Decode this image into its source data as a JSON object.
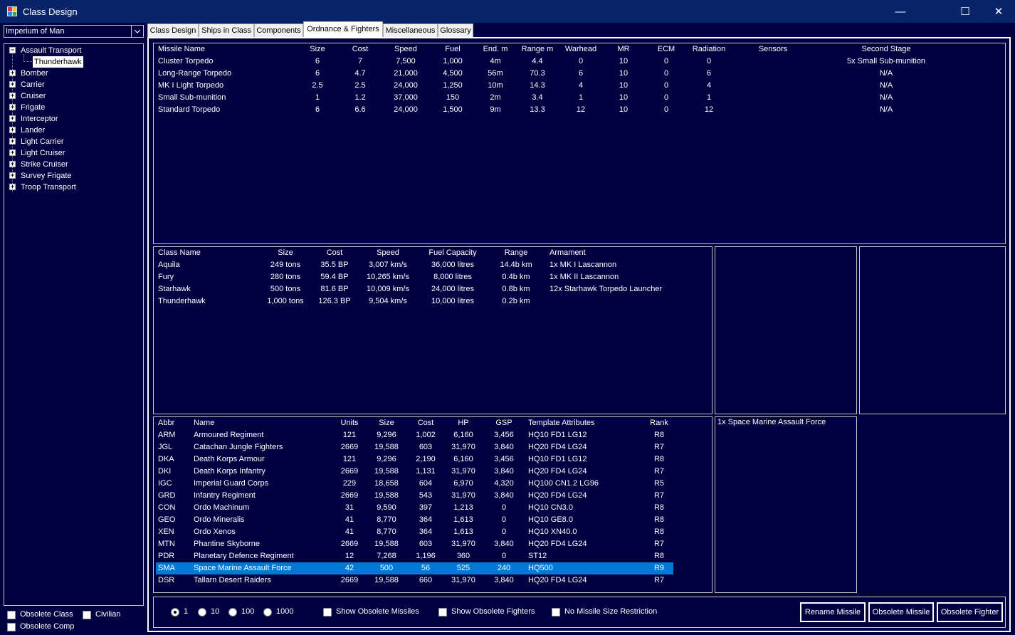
{
  "window": {
    "title": "Class Design",
    "controls": {
      "minimize": "—",
      "maximize": "☐",
      "close": "✕"
    }
  },
  "race_selector": {
    "value": "Imperium of Man"
  },
  "tree": {
    "root_expanded": {
      "label": "Assault Transport",
      "child": "Thunderhawk"
    },
    "items": [
      "Bomber",
      "Carrier",
      "Cruiser",
      "Frigate",
      "Interceptor",
      "Lander",
      "Light Carrier",
      "Light Cruiser",
      "Strike Cruiser",
      "Survey Frigate",
      "Troop Transport"
    ]
  },
  "bottom_left": {
    "obsolete_class": "Obsolete Class",
    "civilian": "Civilian",
    "obsolete_comp": "Obsolete Comp"
  },
  "tabs": [
    "Class Design",
    "Ships in Class",
    "Components",
    "Ordnance & Fighters",
    "Miscellaneous",
    "Glossary"
  ],
  "missiles": {
    "headers": [
      "Missile Name",
      "Size",
      "Cost",
      "Speed",
      "Fuel",
      "End. m",
      "Range m",
      "Warhead",
      "MR",
      "ECM",
      "Radiation",
      "Sensors",
      "Second Stage"
    ],
    "rows": [
      [
        "Cluster Torpedo",
        "6",
        "7",
        "7,500",
        "1,000",
        "4m",
        "4.4",
        "0",
        "10",
        "0",
        "0",
        "",
        "5x Small Sub-munition"
      ],
      [
        "Long-Range Torpedo",
        "6",
        "4.7",
        "21,000",
        "4,500",
        "56m",
        "70.3",
        "6",
        "10",
        "0",
        "6",
        "",
        "N/A"
      ],
      [
        "MK I Light Torpedo",
        "2.5",
        "2.5",
        "24,000",
        "1,250",
        "10m",
        "14.3",
        "4",
        "10",
        "0",
        "4",
        "",
        "N/A"
      ],
      [
        "Small Sub-munition",
        "1",
        "1.2",
        "37,000",
        "150",
        "2m",
        "3.4",
        "1",
        "10",
        "0",
        "1",
        "",
        "N/A"
      ],
      [
        "Standard Torpedo",
        "6",
        "6.6",
        "24,000",
        "1,500",
        "9m",
        "13.3",
        "12",
        "10",
        "0",
        "12",
        "",
        "N/A"
      ]
    ]
  },
  "fighters": {
    "headers": [
      "Class Name",
      "Size",
      "Cost",
      "Speed",
      "Fuel Capacity",
      "Range",
      "Armament"
    ],
    "rows": [
      [
        "Aquila",
        "249 tons",
        "35.5 BP",
        "3,007 km/s",
        "36,000 litres",
        "14.4b km",
        "1x MK I Lascannon"
      ],
      [
        "Fury",
        "280 tons",
        "59.4 BP",
        "10,265 km/s",
        "8,000 litres",
        "0.4b km",
        "1x MK II Lascannon"
      ],
      [
        "Starhawk",
        "500 tons",
        "81.6 BP",
        "10,009 km/s",
        "24,000 litres",
        "0.8b km",
        "12x Starhawk Torpedo Launcher"
      ],
      [
        "Thunderhawk",
        "1,000 tons",
        "126.3 BP",
        "9,504 km/s",
        "10,000 litres",
        "0.2b km",
        ""
      ]
    ]
  },
  "ground_units": {
    "headers": [
      "Abbr",
      "Name",
      "Units",
      "Size",
      "Cost",
      "HP",
      "GSP",
      "Template Attributes",
      "Rank"
    ],
    "selected_index": 11,
    "rows": [
      [
        "ARM",
        "Armoured Regiment",
        "121",
        "9,296",
        "1,002",
        "6,160",
        "3,456",
        "HQ10  FD1  LG12",
        "R8"
      ],
      [
        "JGL",
        "Catachan Jungle Fighters",
        "2669",
        "19,588",
        "603",
        "31,970",
        "3,840",
        "HQ20  FD4  LG24",
        "R7"
      ],
      [
        "DKA",
        "Death Korps Armour",
        "121",
        "9,296",
        "2,190",
        "6,160",
        "3,456",
        "HQ10  FD1  LG12",
        "R8"
      ],
      [
        "DKI",
        "Death Korps Infantry",
        "2669",
        "19,588",
        "1,131",
        "31,970",
        "3,840",
        "HQ20  FD4  LG24",
        "R7"
      ],
      [
        "IGC",
        "Imperial Guard Corps",
        "229",
        "18,658",
        "604",
        "6,970",
        "4,320",
        "HQ100  CN1.2  LG96",
        "R5"
      ],
      [
        "GRD",
        "Infantry Regiment",
        "2669",
        "19,588",
        "543",
        "31,970",
        "3,840",
        "HQ20  FD4  LG24",
        "R7"
      ],
      [
        "CON",
        "Ordo Machinum",
        "31",
        "9,590",
        "397",
        "1,213",
        "0",
        "HQ10  CN3.0",
        "R8"
      ],
      [
        "GEO",
        "Ordo Mineralis",
        "41",
        "8,770",
        "364",
        "1,613",
        "0",
        "HQ10  GE8.0",
        "R8"
      ],
      [
        "XEN",
        "Ordo Xenos",
        "41",
        "8,770",
        "364",
        "1,613",
        "0",
        "HQ10  XN40.0",
        "R8"
      ],
      [
        "MTN",
        "Phantine Skyborne",
        "2669",
        "19,588",
        "603",
        "31,970",
        "3,840",
        "HQ20  FD4  LG24",
        "R7"
      ],
      [
        "PDR",
        "Planetary Defence Regiment",
        "12",
        "7,268",
        "1,196",
        "360",
        "0",
        "ST12",
        "R8"
      ],
      [
        "SMA",
        "Space Marine Assault Force",
        "42",
        "500",
        "56",
        "525",
        "240",
        "HQ500",
        "R9"
      ],
      [
        "DSR",
        "Tallarn Desert Raiders",
        "2669",
        "19,588",
        "660",
        "31,970",
        "3,840",
        "HQ20  FD4  LG24",
        "R7"
      ]
    ]
  },
  "unit_detail": "1x Space Marine Assault Force",
  "bottom_bar": {
    "radios": [
      "1",
      "10",
      "100",
      "1000"
    ],
    "selected_radio": "1",
    "show_obsolete_missiles": "Show Obsolete Missiles",
    "show_obsolete_fighters": "Show Obsolete Fighters",
    "no_missile_size_restriction": "No Missile Size Restriction",
    "rename_missile": "Rename Missile",
    "obsolete_missile": "Obsolete Missile",
    "obsolete_fighter": "Obsolete Fighter"
  },
  "colors": {
    "background": "#000040",
    "highlight": "#0078d7",
    "titlebar": "#0a246a"
  }
}
